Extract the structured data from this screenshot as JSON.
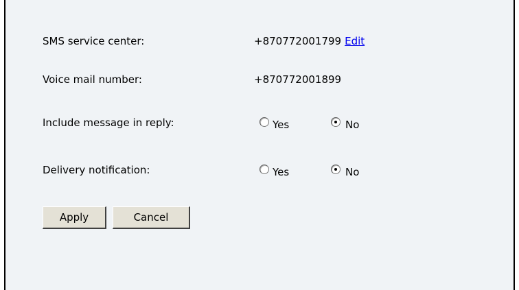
{
  "settings": {
    "sms_service_center": {
      "label": "SMS service center:",
      "value": "+870772001799",
      "edit_link": "Edit"
    },
    "voice_mail_number": {
      "label": "Voice mail number:",
      "value": "+870772001899"
    },
    "include_message_in_reply": {
      "label": "Include message in reply:",
      "options": [
        "Yes",
        "No"
      ],
      "selected": "No"
    },
    "delivery_notification": {
      "label": "Delivery notification:",
      "options": [
        "Yes",
        "No"
      ],
      "selected": "No"
    }
  },
  "buttons": {
    "apply": "Apply",
    "cancel": "Cancel"
  },
  "colors": {
    "panel_background": "#f0f3f6",
    "link": "#0000ee",
    "button_face": "#e4e1d6"
  }
}
